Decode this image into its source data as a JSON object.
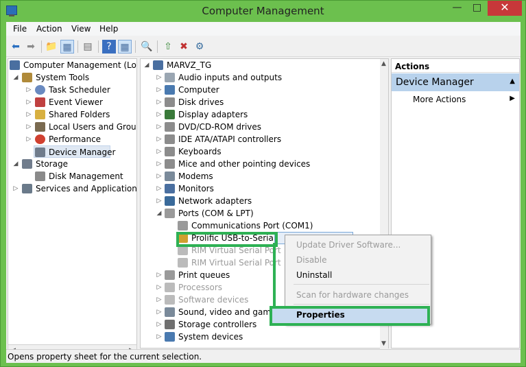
{
  "window": {
    "title": "Computer Management"
  },
  "menubar": [
    "File",
    "Action",
    "View",
    "Help"
  ],
  "left_tree": [
    {
      "label": "Computer Management (Local",
      "level": 0,
      "toggle": "",
      "icon": "computer-management-icon",
      "color": "#4a6fa0"
    },
    {
      "label": "System Tools",
      "level": 1,
      "toggle": "◢",
      "icon": "system-tools-icon",
      "color": "#b08a3a"
    },
    {
      "label": "Task Scheduler",
      "level": 2,
      "toggle": "▷",
      "icon": "clock-icon",
      "color": "#6a8ac0"
    },
    {
      "label": "Event Viewer",
      "level": 2,
      "toggle": "▷",
      "icon": "event-viewer-icon",
      "color": "#c04040"
    },
    {
      "label": "Shared Folders",
      "level": 2,
      "toggle": "▷",
      "icon": "shared-folders-icon",
      "color": "#d8b040"
    },
    {
      "label": "Local Users and Groups",
      "level": 2,
      "toggle": "▷",
      "icon": "users-icon",
      "color": "#7a6a50"
    },
    {
      "label": "Performance",
      "level": 2,
      "toggle": "▷",
      "icon": "performance-icon",
      "color": "#d04030"
    },
    {
      "label": "Device Manager",
      "level": 2,
      "toggle": "",
      "icon": "device-manager-icon",
      "color": "#707c8c",
      "selected": true
    },
    {
      "label": "Storage",
      "level": 0,
      "toggle": "◢",
      "icon": "storage-icon",
      "color": "#707c8c"
    },
    {
      "label": "Disk Management",
      "level": 2,
      "toggle": "",
      "icon": "disk-icon",
      "color": "#8a8a8a"
    },
    {
      "label": "Services and Applications",
      "level": 0,
      "toggle": "▷",
      "icon": "services-icon",
      "color": "#6a7a8a"
    }
  ],
  "device_tree": {
    "root": "MARVZ_TG",
    "items": [
      {
        "label": "Audio inputs and outputs",
        "icon": "speaker-icon",
        "color": "#9aa6b2"
      },
      {
        "label": "Computer",
        "icon": "computer-icon",
        "color": "#4a7ab0"
      },
      {
        "label": "Disk drives",
        "icon": "disk-drive-icon",
        "color": "#8c8c8c"
      },
      {
        "label": "Display adapters",
        "icon": "display-adapter-icon",
        "color": "#3a7a3a"
      },
      {
        "label": "DVD/CD-ROM drives",
        "icon": "dvd-icon",
        "color": "#8c8c8c"
      },
      {
        "label": "IDE ATA/ATAPI controllers",
        "icon": "ide-icon",
        "color": "#8c8c8c"
      },
      {
        "label": "Keyboards",
        "icon": "keyboard-icon",
        "color": "#8c8c8c"
      },
      {
        "label": "Mice and other pointing devices",
        "icon": "mouse-icon",
        "color": "#8c8c8c"
      },
      {
        "label": "Modems",
        "icon": "modem-icon",
        "color": "#7a8a9a"
      },
      {
        "label": "Monitors",
        "icon": "monitor-icon",
        "color": "#4a6fa0"
      },
      {
        "label": "Network adapters",
        "icon": "network-icon",
        "color": "#3a6a9a"
      },
      {
        "label": "Ports (COM & LPT)",
        "icon": "port-icon",
        "color": "#9a9a9a",
        "expanded": true
      },
      {
        "label": "Communications Port (COM1)",
        "icon": "port-icon",
        "color": "#9a9a9a",
        "child": true
      },
      {
        "label": "Prolific USB-to-Serial",
        "icon": "warning-port-icon",
        "color": "#d0a030",
        "child": true,
        "highlight": true
      },
      {
        "label": "RIM Virtual Serial Port",
        "icon": "port-icon",
        "color": "#bbbbbb",
        "child": true,
        "dim": true
      },
      {
        "label": "RIM Virtual Serial Port",
        "icon": "port-icon",
        "color": "#bbbbbb",
        "child": true,
        "dim": true
      },
      {
        "label": "Print queues",
        "icon": "printer-icon",
        "color": "#9a9a9a"
      },
      {
        "label": "Processors",
        "icon": "processor-icon",
        "color": "#bbbbbb",
        "dim": true
      },
      {
        "label": "Software devices",
        "icon": "software-device-icon",
        "color": "#bbbbbb",
        "dim": true
      },
      {
        "label": "Sound, video and game",
        "icon": "sound-icon",
        "color": "#7a8a9a"
      },
      {
        "label": "Storage controllers",
        "icon": "storage-controller-icon",
        "color": "#707070"
      },
      {
        "label": "System devices",
        "icon": "system-device-icon",
        "color": "#4a7ab0"
      }
    ]
  },
  "context_menu": {
    "items": [
      "Update Driver Software...",
      "Disable",
      "Uninstall",
      "Scan for hardware changes"
    ],
    "properties": "Properties"
  },
  "actions_pane": {
    "header": "Actions",
    "section": "Device Manager",
    "more": "More Actions"
  },
  "status": "Opens property sheet for the current selection."
}
